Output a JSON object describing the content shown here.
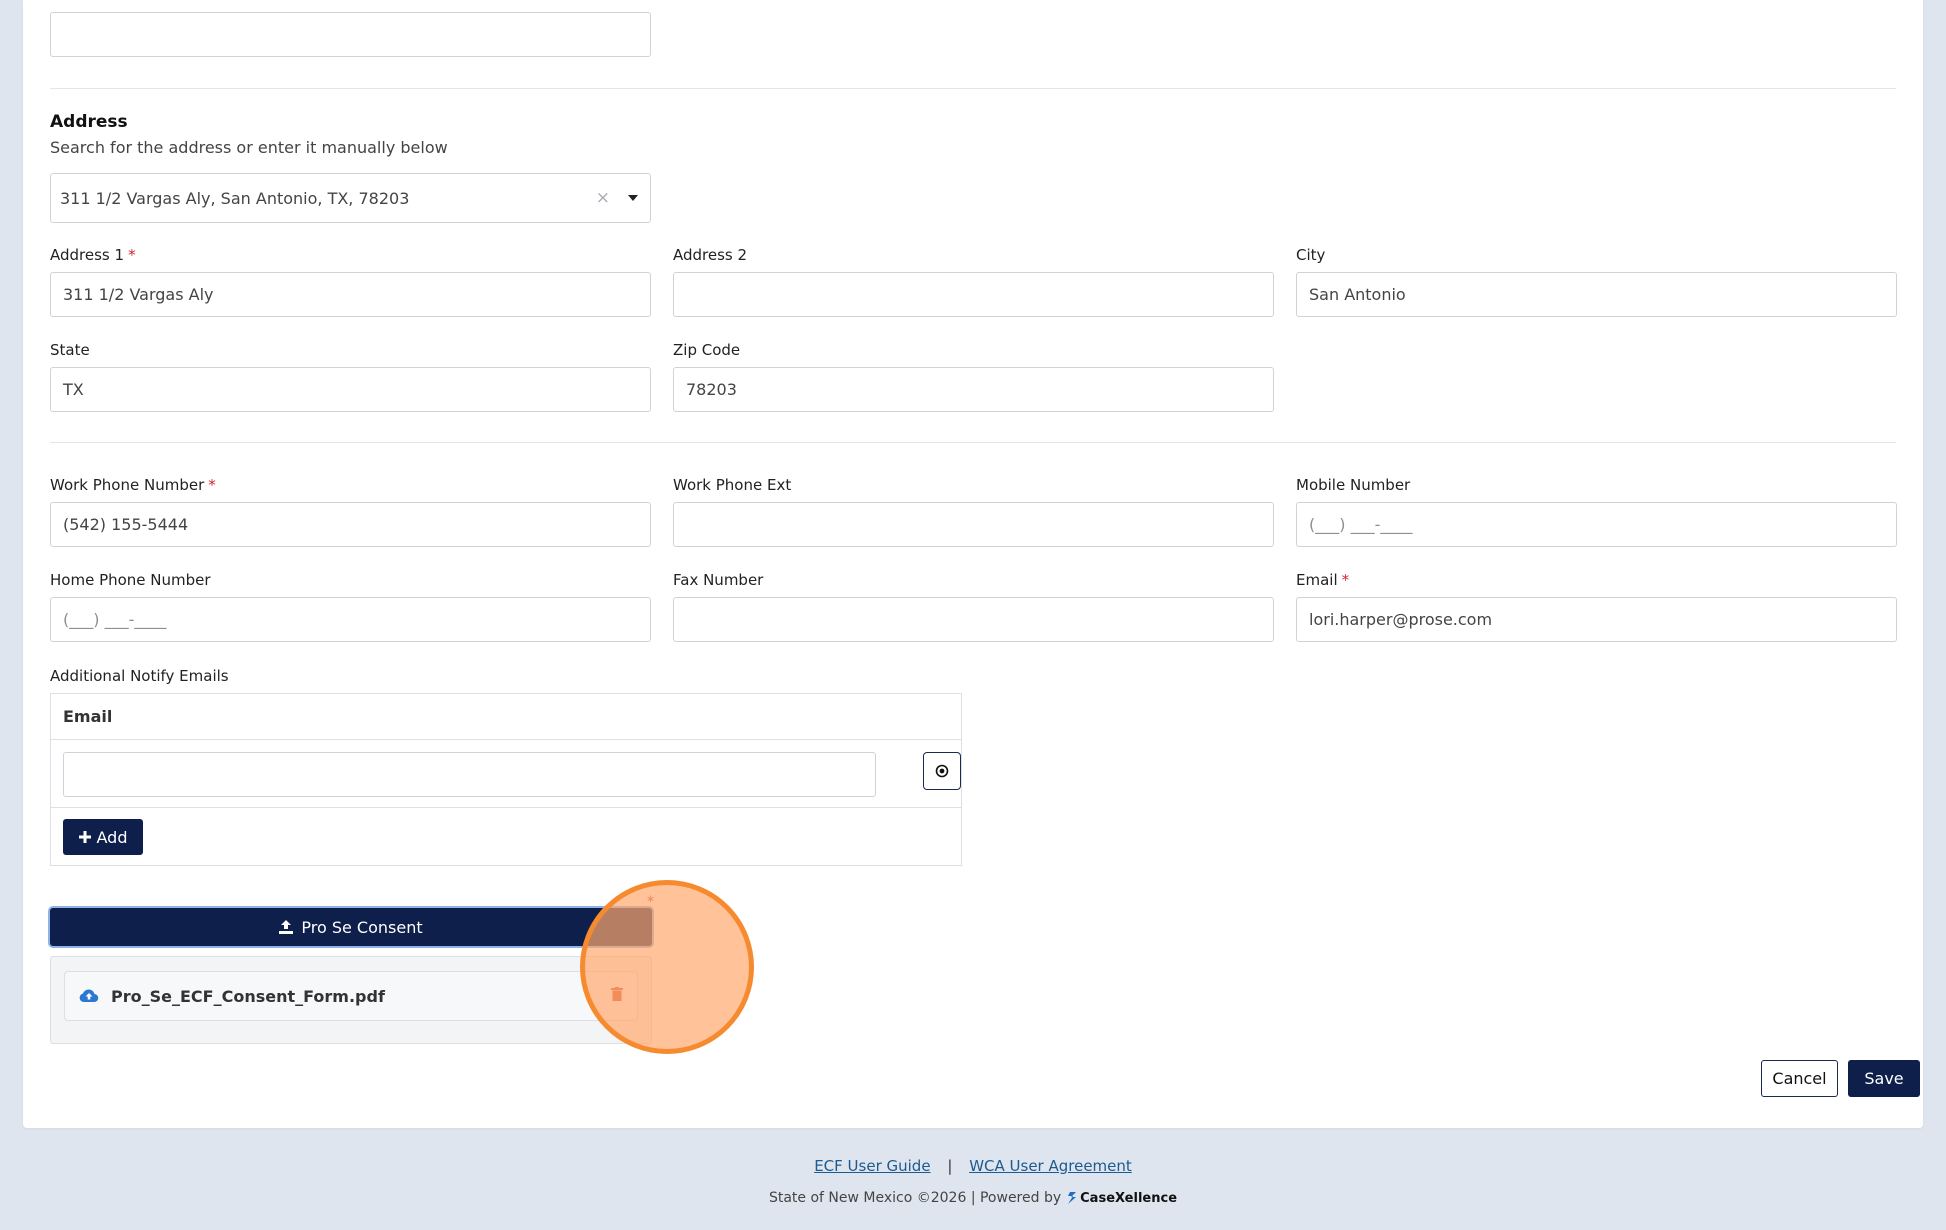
{
  "address": {
    "title": "Address",
    "subtitle": "Search for the address or enter it manually below",
    "search_value": "311 1/2 Vargas Aly, San Antonio, TX, 78203",
    "clear_glyph": "×",
    "address1_label": "Address 1",
    "address1_value": "311 1/2 Vargas Aly",
    "address2_label": "Address 2",
    "address2_value": "",
    "city_label": "City",
    "city_value": "San Antonio",
    "state_label": "State",
    "state_value": "TX",
    "zip_label": "Zip Code",
    "zip_value": "78203"
  },
  "contact": {
    "work_phone_label": "Work Phone Number",
    "work_phone_value": "(542) 155-5444",
    "work_ext_label": "Work Phone Ext",
    "work_ext_value": "",
    "mobile_label": "Mobile Number",
    "mobile_placeholder": "(___) ___-____",
    "home_phone_label": "Home Phone Number",
    "home_phone_placeholder": "(___) ___-____",
    "fax_label": "Fax Number",
    "fax_value": "",
    "email_label": "Email",
    "email_value": "lori.harper@prose.com"
  },
  "required_mark": "*",
  "notify": {
    "label": "Additional Notify Emails",
    "column_header": "Email",
    "email_value": "",
    "add_label": "Add"
  },
  "consent": {
    "button_label": "Pro Se Consent",
    "file_name": "Pro_Se_ECF_Consent_Form.pdf"
  },
  "actions": {
    "cancel_label": "Cancel",
    "save_label": "Save"
  },
  "footer": {
    "guide_link": "ECF User Guide",
    "separator": "|",
    "agreement_link": "WCA User Agreement",
    "copyright": "State of New Mexico ©2026 | Powered by",
    "brand": "CaseXellence"
  },
  "colors": {
    "primary": "#0d1f4a",
    "required": "#d0262d",
    "link": "#1d5a8f",
    "page_bg": "#dfe5ee",
    "highlight": "#f58a2e"
  }
}
